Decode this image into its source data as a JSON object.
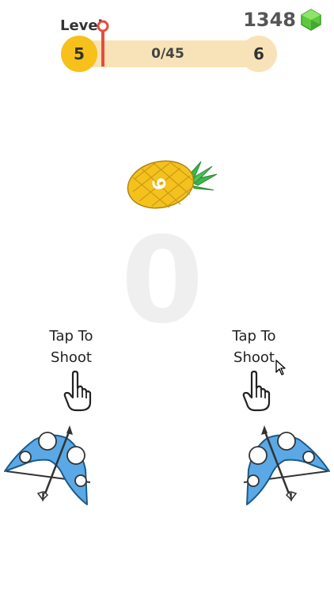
{
  "hud": {
    "level_label": "Level",
    "current_level": "5",
    "next_level": "6",
    "progress_text": "0/45",
    "progress_fraction": 0.0,
    "gem_count": "1348",
    "gem_icon": "gem-icon"
  },
  "game": {
    "score": "0",
    "fruit": "pineapple",
    "fruit_digit": "6",
    "left_prompt": {
      "line1": "Tap To",
      "line2": "Shoot"
    },
    "right_prompt": {
      "line1": "Tap To",
      "line2": "Shoot"
    }
  },
  "colors": {
    "level_current": "#f7c01b",
    "track": "#f8e3b8",
    "marker": "#e74c3c",
    "gem": "#5cc93d",
    "bow": "#5aa9e6",
    "pineapple": "#f4c21c",
    "leaves": "#3db54a"
  }
}
